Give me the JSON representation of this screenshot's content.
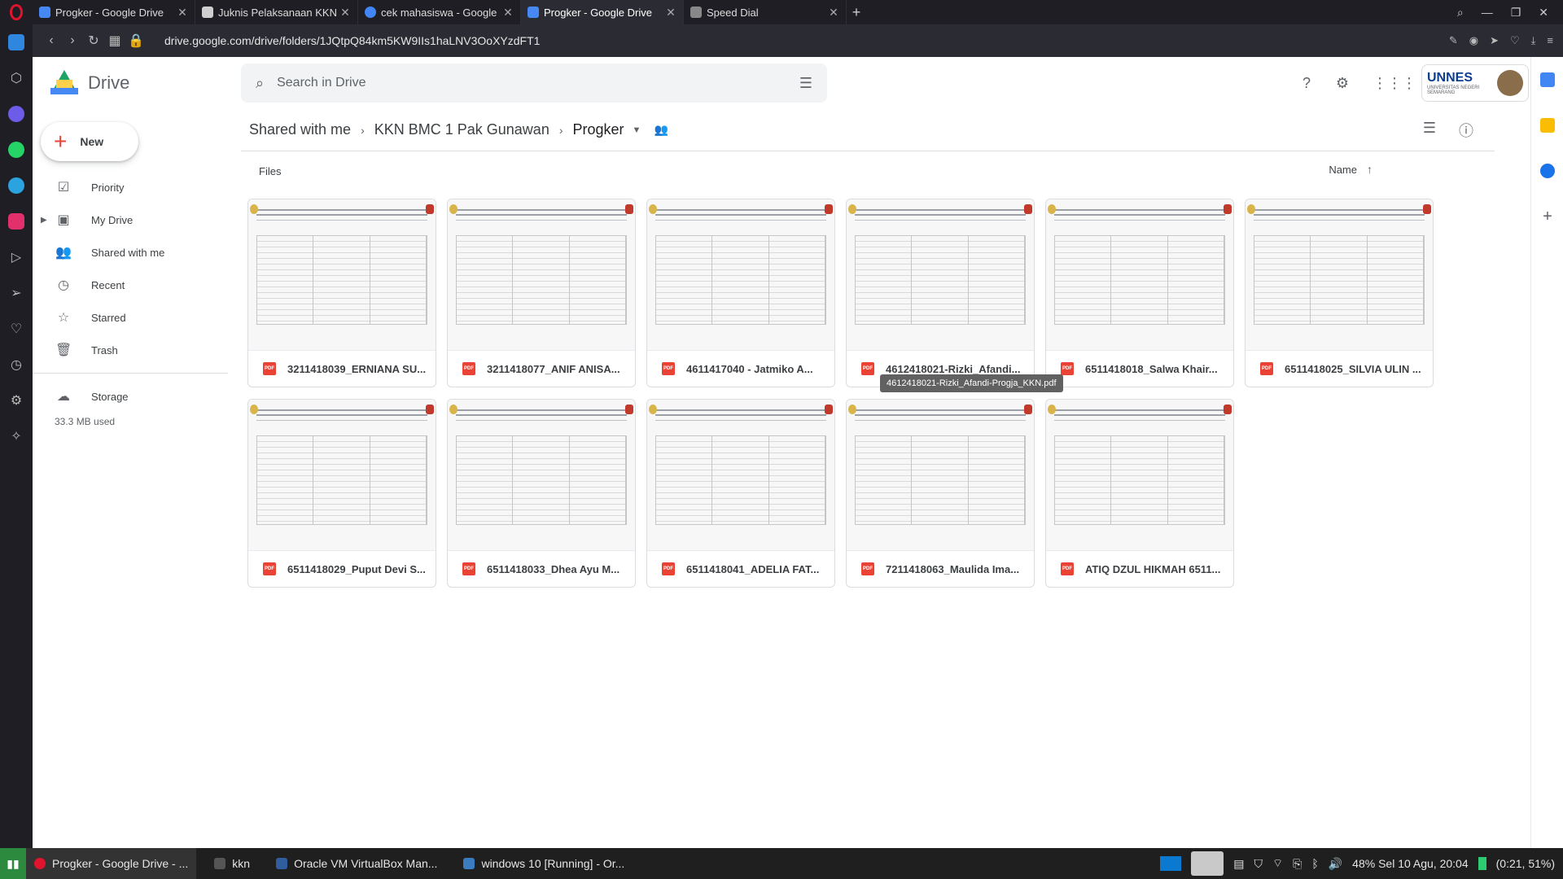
{
  "browser": {
    "tabs": [
      {
        "title": "Progker - Google Drive",
        "color": "#4688f4"
      },
      {
        "title": "Juknis Pelaksanaan KKN",
        "color": "#cfcfcf"
      },
      {
        "title": "cek mahasiswa - Google",
        "color": "#4285f4"
      },
      {
        "title": "Progker - Google Drive",
        "color": "#4688f4",
        "active": true
      },
      {
        "title": "Speed Dial",
        "color": "#888888"
      }
    ],
    "url": "drive.google.com/drive/folders/1JQtpQ84km5KW9IIs1haLNV3OoXYzdFT1"
  },
  "drive": {
    "brand": "Drive",
    "search_placeholder": "Search in Drive",
    "account_logo": "UNNES",
    "account_sub": "UNIVERSITAS NEGERI SEMARANG",
    "new_label": "New",
    "nav": [
      {
        "label": "Priority",
        "icon": "priority-icon"
      },
      {
        "label": "My Drive",
        "icon": "my-drive-icon"
      },
      {
        "label": "Shared with me",
        "icon": "shared-icon"
      },
      {
        "label": "Recent",
        "icon": "recent-icon"
      },
      {
        "label": "Starred",
        "icon": "star-icon"
      },
      {
        "label": "Trash",
        "icon": "trash-icon"
      }
    ],
    "storage_label": "Storage",
    "storage_used": "33.3 MB used",
    "breadcrumb": [
      "Shared with me",
      "KKN BMC 1 Pak Gunawan",
      "Progker"
    ],
    "section_label": "Files",
    "sort_label": "Name",
    "files": [
      "3211418039_ERNIANA SU...",
      "3211418077_ANIF ANISA...",
      "4611417040 - Jatmiko A...",
      "4612418021-Rizki_Afandi...",
      "6511418018_Salwa Khair...",
      "6511418025_SILVIA ULIN ...",
      "6511418029_Puput Devi S...",
      "6511418033_Dhea Ayu M...",
      "6511418041_ADELIA FAT...",
      "7211418063_Maulida Ima...",
      "ATIQ DZUL HIKMAH 6511..."
    ],
    "tooltip": "4612418021-Rizki_Afandi-Progja_KKN.pdf"
  },
  "taskbar": {
    "items": [
      "Progker - Google Drive - ...",
      "kkn",
      "Oracle VM VirtualBox Man...",
      "windows 10 [Running] - Or..."
    ],
    "status": "48%  Sel 10 Agu, 20:04",
    "battery": "(0:21, 51%)"
  }
}
